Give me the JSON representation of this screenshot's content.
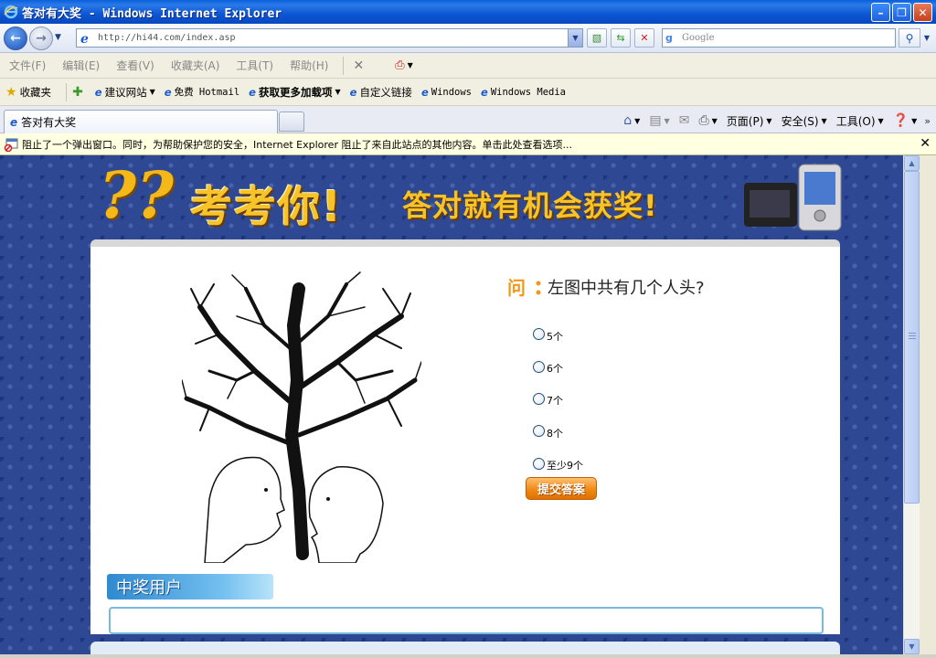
{
  "window": {
    "title": "答对有大奖 - Windows Internet Explorer",
    "minimize": "–",
    "maximize": "❐",
    "close": "✕"
  },
  "address": {
    "url": "http://hi44.com/index.asp",
    "search_placeholder": "Google"
  },
  "menu": {
    "items": [
      "文件(F)",
      "编辑(E)",
      "查看(V)",
      "收藏夹(A)",
      "工具(T)",
      "帮助(H)"
    ]
  },
  "favorites": {
    "favorites_label": "收藏夹",
    "suggested_sites": "建议网站",
    "free_hotmail": "免费 Hotmail",
    "get_addons": "获取更多加载项",
    "custom_links": "自定义链接",
    "windows": "Windows",
    "windows_media": "Windows Media"
  },
  "tabs": {
    "active_tab": "答对有大奖"
  },
  "commandbar": {
    "page": "页面(P)",
    "safety": "安全(S)",
    "tools": "工具(O)",
    "more": "»"
  },
  "infobar": {
    "message": "阻止了一个弹出窗口。同时，为帮助保护您的安全，Internet Explorer 阻止了来自此站点的其他内容。单击此处查看选项..."
  },
  "page": {
    "banner_title": "考考你!",
    "banner_subtitle": "答对就有机会获奖!",
    "question": "左图中共有几个人头?",
    "options": [
      "5个",
      "6个",
      "7个",
      "8个",
      "至少9个"
    ],
    "submit_label": "提交答案",
    "winners_label": "中奖用户"
  },
  "colors": {
    "page_background": "#2e4894",
    "banner_text": "#f6c428",
    "submit_button": "#f08a14",
    "winners_label": "#2f8ad0"
  }
}
